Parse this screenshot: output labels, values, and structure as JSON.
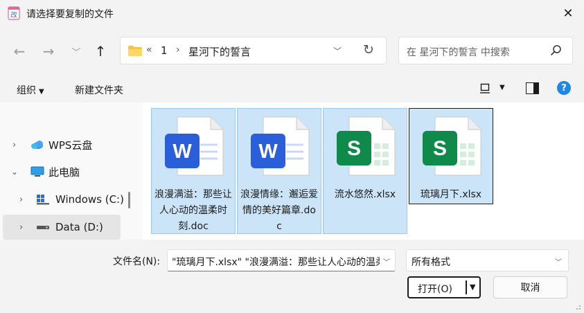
{
  "window": {
    "title": "请选择要复制的文件"
  },
  "nav": {
    "back": "back-arrow",
    "forward": "forward-arrow",
    "recent": "chevron-down",
    "up": "up-arrow"
  },
  "address": {
    "overflow": "«",
    "crumbs": [
      "1",
      "星河下的誓言"
    ],
    "separator": "›"
  },
  "search": {
    "placeholder": "在 星河下的誓言 中搜索"
  },
  "toolbar": {
    "organize": "组织",
    "new_folder": "新建文件夹"
  },
  "sidebar": {
    "items": [
      {
        "label": "WPS云盘",
        "icon": "cloud-icon",
        "expanded": false
      },
      {
        "label": "此电脑",
        "icon": "computer-icon",
        "expanded": true
      },
      {
        "label": "Windows (C:)",
        "icon": "windows-drive-icon",
        "expanded": false
      },
      {
        "label": "Data (D:)",
        "icon": "drive-icon",
        "expanded": false,
        "selected": true
      }
    ]
  },
  "files": [
    {
      "name": "浪漫满溢：那些让人心动的温柔时刻.doc",
      "type": "word",
      "selected": true
    },
    {
      "name": "浪漫情缘：邂逅爱情的美好篇章.doc",
      "type": "word",
      "selected": true
    },
    {
      "name": "流水悠然.xlsx",
      "type": "excel",
      "selected": true
    },
    {
      "name": "琉璃月下.xlsx",
      "type": "excel",
      "selected": true,
      "focused": true
    }
  ],
  "bottom": {
    "filename_label": "文件名(N):",
    "filename_value": "\"琉璃月下.xlsx\" \"浪漫满溢：那些让人心动的温柔时刻.doc\"",
    "filter_value": "所有格式",
    "open_label": "打开(O)",
    "cancel_label": "取消"
  },
  "colors": {
    "accent": "#1e88e5",
    "selection": "#cce4f7",
    "word": "#2b5fd9",
    "excel": "#0f8a4a"
  }
}
